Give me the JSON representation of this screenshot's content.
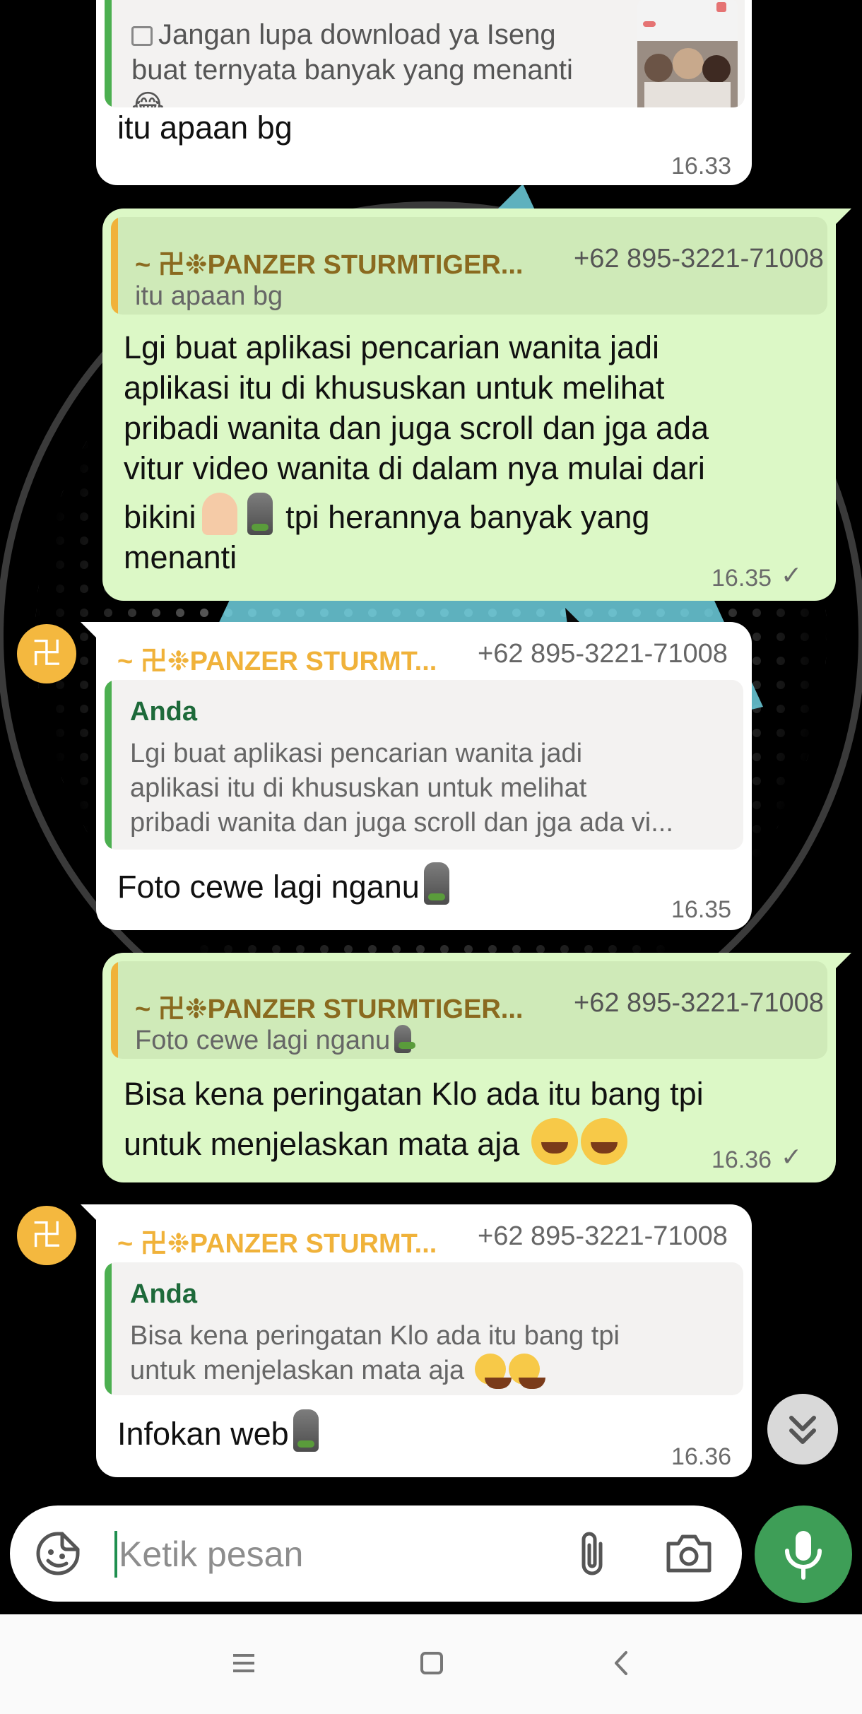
{
  "prev_message": {
    "quote_text": "Jangan lupa download ya Iseng buat ternyata banyak yang menanti",
    "text": "itu apaan bg",
    "time": "16.33"
  },
  "messages": [
    {
      "direction": "outgoing",
      "quote_author": "~ 卍❉PANZER STURMTIGER...",
      "quote_phone": "+62 895-3221-71008",
      "quote_text": "itu apaan bg",
      "text_line1": "Lgi buat aplikasi pencarian wanita jadi",
      "text_line2": "aplikasi itu di khususkan untuk melihat",
      "text_line3": "pribadi wanita dan juga scroll dan jga ada",
      "text_line4": "vitur video wanita di dalam nya mulai dari",
      "text_line5a": "bikini",
      "text_line5b": "tpi herannya banyak yang",
      "text_line6": "menanti",
      "time": "16.35"
    },
    {
      "direction": "incoming",
      "sender": "~ 卍❉PANZER STURMT...",
      "sender_phone": "+62 895-3221-71008",
      "quote_author": "Anda",
      "quote_line1": "Lgi buat aplikasi pencarian wanita jadi",
      "quote_line2": "aplikasi itu di khususkan untuk melihat",
      "quote_line3": "pribadi wanita dan juga scroll dan jga ada vi...",
      "text": "Foto cewe lagi nganu",
      "time": "16.35"
    },
    {
      "direction": "outgoing",
      "quote_author": "~ 卍❉PANZER STURMTIGER...",
      "quote_phone": "+62 895-3221-71008",
      "quote_text": "Foto cewe lagi nganu",
      "text_line1": "Bisa kena peringatan Klo ada itu bang tpi",
      "text_line2": "untuk menjelaskan mata aja",
      "time": "16.36"
    },
    {
      "direction": "incoming",
      "sender": "~ 卍❉PANZER STURMT...",
      "sender_phone": "+62 895-3221-71008",
      "quote_author": "Anda",
      "quote_line1": "Bisa kena peringatan Klo ada itu bang tpi",
      "quote_line2": "untuk menjelaskan mata aja",
      "text": "Infokan web",
      "time": "16.36"
    }
  ],
  "avatar_glyph": "卍",
  "input": {
    "placeholder": "Ketik pesan"
  },
  "icons": {
    "emoji": "sticker-icon",
    "attach": "paperclip-icon",
    "camera": "camera-icon",
    "mic": "microphone-icon",
    "scroll": "double-chevron-down-icon",
    "read": "checkmark-icon"
  },
  "colors": {
    "outgoing_bubble": "#dcf8c6",
    "incoming_bubble": "#ffffff",
    "sender_name": "#f0b23a",
    "quote_author": "#1d6a3a",
    "accent_green": "#3e9e57"
  }
}
